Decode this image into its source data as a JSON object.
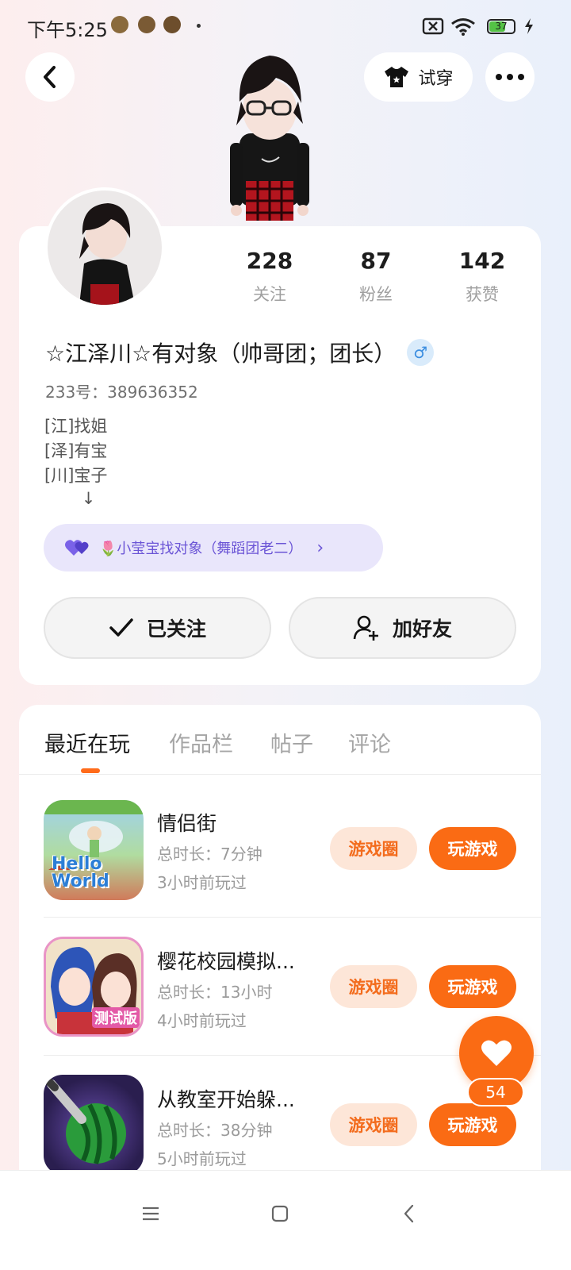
{
  "status_bar": {
    "time": "下午5:25",
    "battery": "37"
  },
  "header": {
    "try_on_label": "试穿"
  },
  "profile": {
    "stats": [
      {
        "value": "228",
        "label": "关注"
      },
      {
        "value": "87",
        "label": "粉丝"
      },
      {
        "value": "142",
        "label": "获赞"
      }
    ],
    "name": "☆江泽川☆有对象（帅哥团；团长）",
    "gender_symbol": "♂",
    "uid": "233号：389636352",
    "bio_lines": [
      "[江]找姐",
      "[泽]有宝",
      "[川]宝子",
      "       ↓"
    ],
    "couple_label": "🌷小莹宝找对象（舞蹈团老二）",
    "follow_label": "已关注",
    "add_friend_label": "加好友"
  },
  "tabs": [
    {
      "label": "最近在玩",
      "active": true
    },
    {
      "label": "作品栏",
      "active": false
    },
    {
      "label": "帖子",
      "active": false
    },
    {
      "label": "评论",
      "active": false
    }
  ],
  "games": [
    {
      "title": "情侣街",
      "duration": "总时长：7分钟",
      "last_played": "3小时前玩过",
      "icon_text": "Hello World",
      "circle_label": "游戏圈",
      "play_label": "玩游戏"
    },
    {
      "title": "樱花校园模拟...",
      "duration": "总时长：13小时",
      "last_played": "4小时前玩过",
      "icon_text": "测试版",
      "circle_label": "游戏圈",
      "play_label": "玩游戏"
    },
    {
      "title": "从教室开始躲...",
      "duration": "总时长：38分钟",
      "last_played": "5小时前玩过",
      "icon_text": "",
      "circle_label": "游戏圈",
      "play_label": "玩游戏"
    }
  ],
  "like_count": "54"
}
